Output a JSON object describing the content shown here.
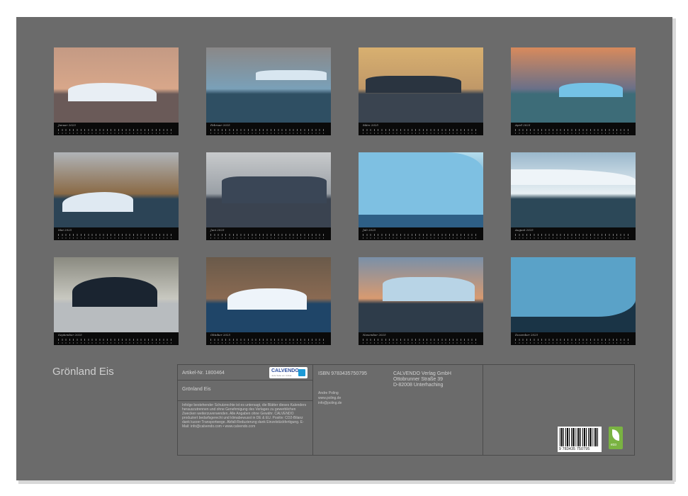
{
  "calendar": {
    "title": "Grönland Eis",
    "months": [
      {
        "label": "Januar 2025",
        "sky": "#c49a84",
        "sky2": "#d8a78a",
        "water": "#6a5a58"
      },
      {
        "label": "Februar 2025",
        "sky": "#8a8888",
        "sky2": "#7aa0b8",
        "water": "#2f4f63"
      },
      {
        "label": "März 2025",
        "sky": "#d8b070",
        "sky2": "#c09868",
        "water": "#3a4450"
      },
      {
        "label": "April 2025",
        "sky": "#d88a5c",
        "sky2": "#6a7088",
        "water": "#3d6c78"
      },
      {
        "label": "Mai 2025",
        "sky": "#b0b4b8",
        "sky2": "#8a6a46",
        "water": "#2c4456"
      },
      {
        "label": "Juni 2025",
        "sky": "#c8cacc",
        "sky2": "#9aa0a6",
        "water": "#3a4350"
      },
      {
        "label": "Juli 2025",
        "sky": "#b4dcec",
        "sky2": "#5a9cc8",
        "water": "#2e5f86"
      },
      {
        "label": "August 2025",
        "sky": "#9ab8cc",
        "sky2": "#e8f0f4",
        "water": "#2c4858"
      },
      {
        "label": "September 2025",
        "sky": "#8a8a80",
        "sky2": "#c8c8c0",
        "water": "#b8bcbf"
      },
      {
        "label": "Oktober 2025",
        "sky": "#6a5a4a",
        "sky2": "#8a6a52",
        "water": "#1f4568"
      },
      {
        "label": "November 2025",
        "sky": "#7a90a8",
        "sky2": "#d89a70",
        "water": "#2e3c4a"
      },
      {
        "label": "Dezember 2025",
        "sky": "#3a6a8a",
        "sky2": "#7ab4d4",
        "water": "#1a3446"
      }
    ]
  },
  "info": {
    "article_label": "Artikel-Nr. 1800464",
    "product_title": "Grönland Eis",
    "legal_text": "Infolge bestehender Schutzrechte ist es untersagt, die Blätter dieses Kalenders herauszutrennen und ohne Genehmigung des Verlages zu gewerblichen Zwecken weiterzuverwenden. Alle Angaben ohne Gewähr. CALVENDO produziert bedarfsgerecht und klimabewusst in DE & EU. Positiv: CO2-Bilanz dank kurzer Transportwege. Abfall-Reduzierung dank Einzelstückfertigung. E-Mail: info@calvendo.com • www.calvendo.com",
    "logo_text": "CALVENDO",
    "logo_sub": "Jede Seite ein Unikat",
    "isbn": "ISBN 9783435750795",
    "publisher_name": "CALVENDO Verlag GmbH",
    "publisher_street": "Ottobrunner Straße 39",
    "publisher_city": "D-82008 Unterhaching",
    "author_name": "Andre Poling",
    "author_web": "www.poling.de",
    "author_email": "info@poling.de",
    "barcode_number": "9 783435 750795",
    "eco_label": "eco"
  }
}
